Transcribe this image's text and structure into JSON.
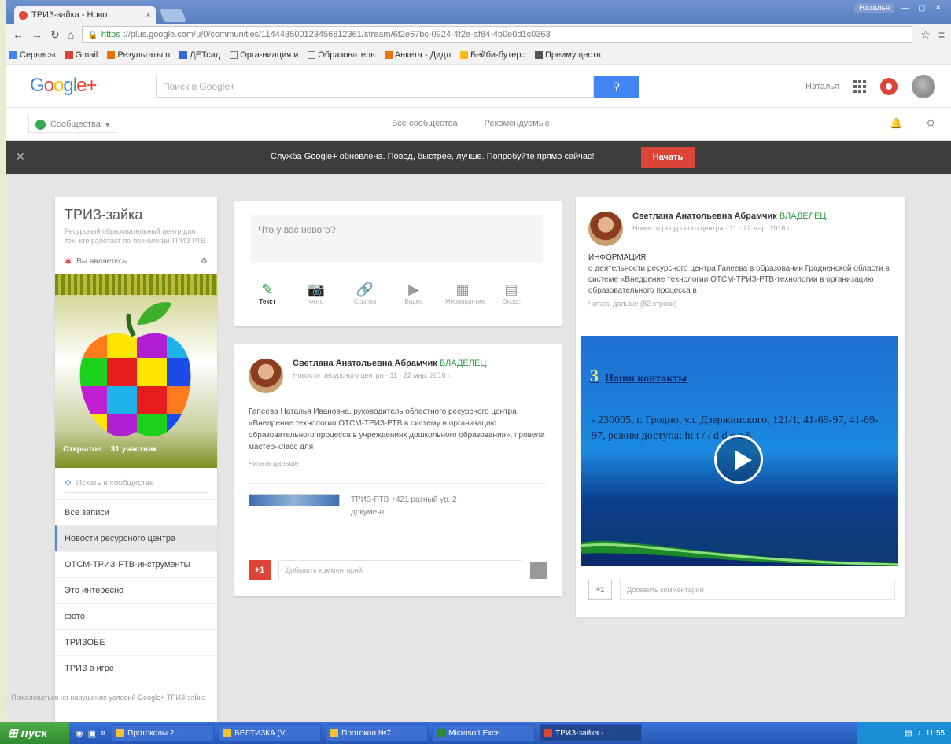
{
  "browser": {
    "tab_title": "ТРИЗ-зайка - Ново",
    "tab_close": "×",
    "window_user": "Наталья",
    "window_min": "—",
    "window_max": "▢",
    "window_close": "✕",
    "url_https": "https",
    "url_rest": "://plus.google.com/u/0/communities/114443500123456812361/stream/6f2e67bc-0924-4f2e-af84-4b0e0d1c0363"
  },
  "bookmarks": [
    {
      "label": "Сервисы",
      "icon": "apps-icon",
      "color": "#4285f4"
    },
    {
      "label": "Gmail",
      "icon": "gmail-icon",
      "color": "#db4437"
    },
    {
      "label": "Результаты п",
      "icon": "result-icon",
      "color": "#e8710a"
    },
    {
      "label": "ДЕТсад",
      "icon": "kindergarten-icon",
      "color": "#3367d6"
    },
    {
      "label": "Орга-ниация и",
      "icon": "page-icon",
      "color": "#777777"
    },
    {
      "label": "Образователь",
      "icon": "page-icon",
      "color": "#777777"
    },
    {
      "label": "Анкета - Дидл",
      "icon": "survey-icon",
      "color": "#e8710a"
    },
    {
      "label": "Бейби-бутерс",
      "icon": "baby-icon",
      "color": "#fbbc05"
    },
    {
      "label": "Преимуществ",
      "icon": "person-icon",
      "color": "#555555"
    }
  ],
  "header": {
    "logo_g": "G",
    "logo_o1": "o",
    "logo_o2": "o",
    "logo_g2": "g",
    "logo_l": "l",
    "logo_e": "e",
    "logo_plus": "+",
    "search_placeholder": "Поиск в Google+",
    "search_icon": "⚲",
    "user_name": "Наталья"
  },
  "subnav": {
    "communities": "Сообщества",
    "link_all": "Все сообщества",
    "link_mine": "Рекомендуемые",
    "bell": "🔔",
    "settings": "⚙"
  },
  "banner": {
    "close": "✕",
    "text": "Служба Google+ обновлена. Повод, быстрее, лучше. Попробуйте прямо сейчас!",
    "button": "Начать"
  },
  "community": {
    "name": "ТРИЗ-зайка",
    "description": "Ресурсный образовательный центр для тех, кто работает по технологии ТРИЗ-РТВ",
    "member_label": "Вы являетесь",
    "caption_public": "Открытое",
    "caption_members": "31 участник",
    "search_placeholder": "Искать в сообществе",
    "categories": [
      {
        "label": "Все записи",
        "selected": false
      },
      {
        "label": "Новости ресурсного центра",
        "selected": true
      },
      {
        "label": "ОТСМ-ТРИЗ-РТВ-инструменты",
        "selected": false
      },
      {
        "label": "Это интересно",
        "selected": false
      },
      {
        "label": "фото",
        "selected": false
      },
      {
        "label": "ТРИЗОБЕ",
        "selected": false
      },
      {
        "label": "ТРИЗ в игре",
        "selected": false
      }
    ]
  },
  "composer": {
    "prompt": "Что у вас нового?",
    "tools": [
      {
        "label": "Текст",
        "icon": "pencil-icon",
        "glyph": "✎"
      },
      {
        "label": "Фото",
        "icon": "camera-icon",
        "glyph": "📷"
      },
      {
        "label": "Ссылка",
        "icon": "link-icon",
        "glyph": "🔗"
      },
      {
        "label": "Видео",
        "icon": "video-icon",
        "glyph": "▶"
      },
      {
        "label": "Мероприятие",
        "icon": "calendar-icon",
        "glyph": "▦"
      },
      {
        "label": "Опрос",
        "icon": "poll-icon",
        "glyph": "▤"
      }
    ]
  },
  "post1": {
    "author": "Светлана Анатольевна Абрамчик",
    "tag": "ВЛАДЕЛЕЦ",
    "meta": "Новости ресурсного центра · 11 · 22 мар. 2016 г.",
    "text": "Гапеева Наталья Ивановна, руководитель областного ресурсного центра «Внедрение технологии ОТСМ-ТРИЗ-РТВ в систему и организацию образовательного процесса в учреждениях дошкольного образования», провела мастер-класс для",
    "more": "Читать дальше",
    "attachment": "ТРИЗ-РТВ +421 разный ур. 2 документ",
    "plus": "+1",
    "comment_placeholder": "Добавить комментарий"
  },
  "post2": {
    "author": "Светлана Анатольевна Абрамчик",
    "tag": "ВЛАДЕЛЕЦ",
    "meta": "Новости ресурсного центра · 11 · 22 мар. 2016 г.",
    "heading": "ИНФОРМАЦИЯ",
    "text": "о деятельности ресурсного центра Гапеева в образовании Гродненской области в системе «Внедрение технологии ОТСМ-ТРИЗ-РТВ-технологии в организацию образовательного процесса в",
    "more": "Читать дальше (82 строки)",
    "video_num": "3",
    "video_title": "Наши контакты",
    "video_text": "- 230005, г. Гродно, ул. Дзержинского, 121/1, 41-69-97, 41-69-97, режим доступа: ht t   /   /   d   d   o   z   8",
    "plus": "+1",
    "comment_placeholder": "Добавить комментарий"
  },
  "footnote": "Пожаловаться на нарушение условий Google+ ТРИЗ-зайка",
  "taskbar": {
    "start": "пуск",
    "tasks": [
      {
        "label": "Протоколы 2...",
        "active": false
      },
      {
        "label": "БЕЛТИЗКА (V...",
        "active": false
      },
      {
        "label": "Протокол №7 ...",
        "active": false
      },
      {
        "label": "Microsoft Exce...",
        "active": false
      },
      {
        "label": "ТРИЗ-зайка - ...",
        "active": true
      }
    ],
    "clock": "11:55"
  }
}
